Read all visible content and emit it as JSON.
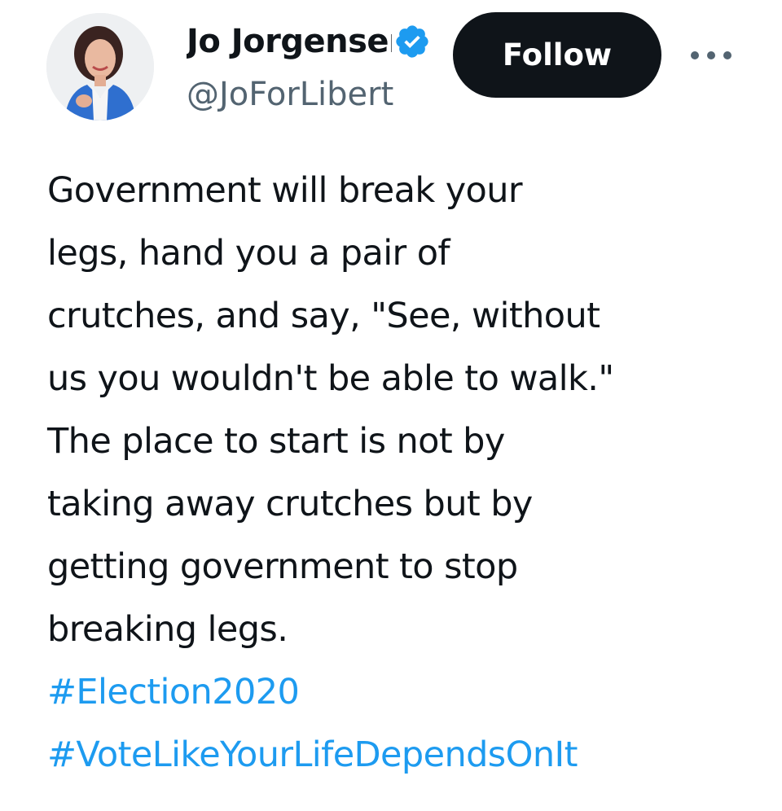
{
  "author": {
    "display_name": "Jo Jorgensen",
    "handle": "@JoForLibert",
    "verified": true,
    "avatar_icon": "profile-photo",
    "verified_icon": "verified-badge-icon"
  },
  "header": {
    "follow_label": "Follow",
    "more_icon": "more-options-icon"
  },
  "tweet": {
    "lines": [
      "Government will break your",
      "legs, hand you a pair of",
      "crutches, and say, \"See, without",
      "us you wouldn't be able to walk.\"",
      "The place to start is not by",
      "taking away crutches but by",
      "getting government to stop",
      "breaking legs."
    ],
    "hashtags": [
      "#Election2020",
      "#VoteLikeYourLifeDependsOnIt"
    ]
  },
  "colors": {
    "text": "#0f1419",
    "secondary_text": "#536471",
    "link": "#1d9bf0",
    "follow_button_bg": "#0f1419",
    "verified_badge": "#1d9bf0"
  }
}
